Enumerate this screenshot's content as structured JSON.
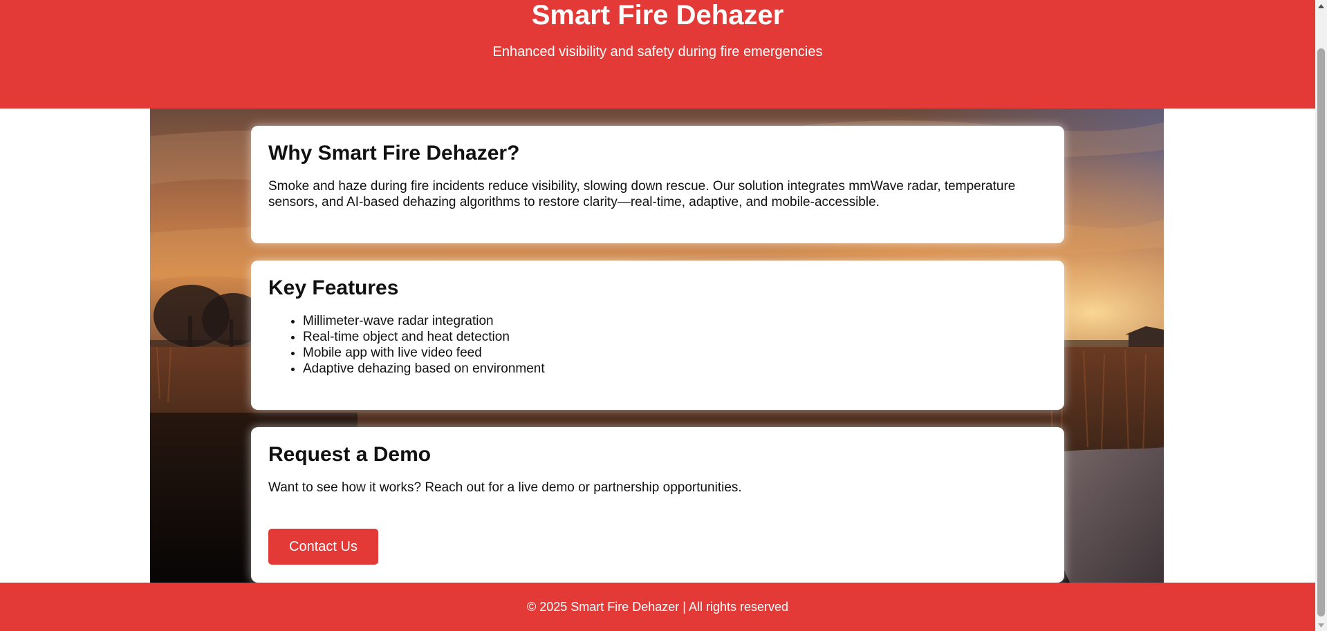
{
  "header": {
    "title": "Smart Fire Dehazer",
    "tagline": "Enhanced visibility and safety during fire emergencies"
  },
  "sections": {
    "why": {
      "heading": "Why Smart Fire Dehazer?",
      "body": "Smoke and haze during fire incidents reduce visibility, slowing down rescue. Our solution integrates mmWave radar, temperature sensors, and AI-based dehazing algorithms to restore clarity—real-time, adaptive, and mobile-accessible."
    },
    "features": {
      "heading": "Key Features",
      "items": [
        "Millimeter-wave radar integration",
        "Real-time object and heat detection",
        "Mobile app with live video feed",
        "Adaptive dehazing based on environment"
      ]
    },
    "demo": {
      "heading": "Request a Demo",
      "body": "Want to see how it works? Reach out for a live demo or partnership opportunities.",
      "button_label": "Contact Us"
    }
  },
  "footer": {
    "text": "© 2025 Smart Fire Dehazer | All rights reserved"
  },
  "colors": {
    "brand_red": "#e43a37",
    "card_bg": "#ffffff",
    "text": "#111111"
  }
}
